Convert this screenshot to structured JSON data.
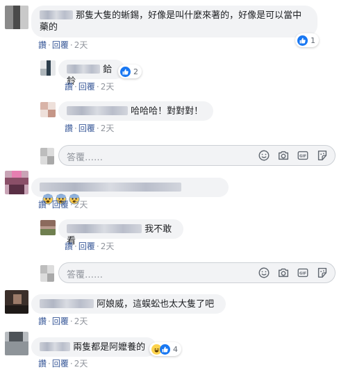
{
  "actions": {
    "like": "讚",
    "reply": "回覆",
    "separator": "·"
  },
  "reply_placeholder": "答覆……",
  "comments": [
    {
      "text": "那隻大隻的蜥錫，好像是叫什麼來著的，好像是可以當中藥的",
      "time": "2天",
      "reaction_count": "1"
    },
    {
      "text": "鉿鈴",
      "time": "2天",
      "reaction_count": "2"
    },
    {
      "text": "哈哈哈！對對對！",
      "time": "2天"
    },
    {
      "text": "",
      "time": "2天"
    },
    {
      "text": "我不敢看",
      "time": "2天"
    },
    {
      "text": "阿娘威，這蜈蚣也太大隻了吧",
      "time": "2天"
    },
    {
      "text": "兩隻都是阿嬤養的",
      "time": "2天",
      "reaction_count": "4"
    }
  ],
  "colors": {
    "link": "#385898",
    "muted": "#90949c",
    "bubble": "#f2f3f5",
    "like_blue": "#1877f2"
  },
  "icons": [
    "like-icon",
    "haha-icon",
    "fearful-emoji-icon",
    "smiley-icon",
    "camera-icon",
    "gif-icon",
    "sticker-icon"
  ]
}
